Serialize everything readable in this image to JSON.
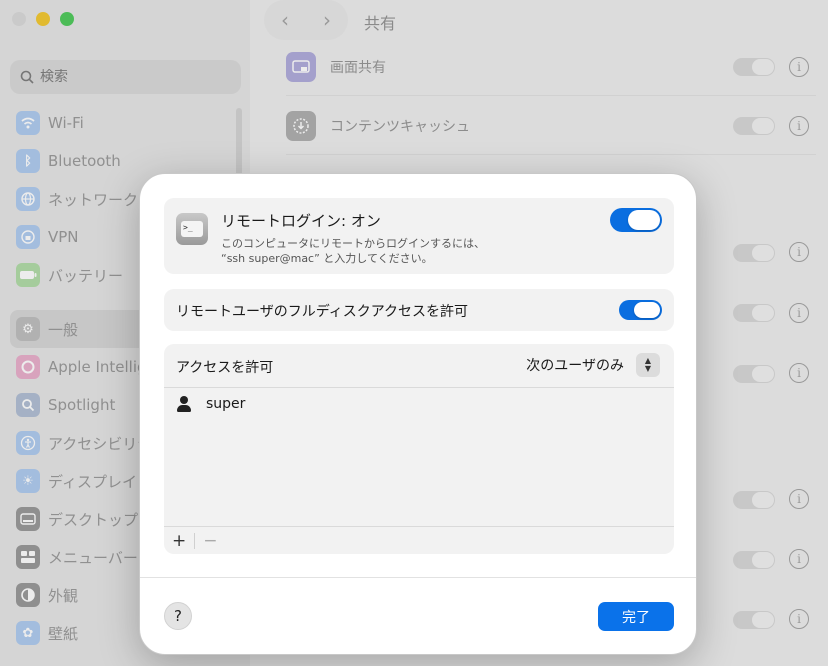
{
  "sidebar": {
    "search_placeholder": "検索",
    "items": [
      {
        "label": "Wi-Fi",
        "icon": "wifi-icon",
        "color": "#a7c6ee"
      },
      {
        "label": "Bluetooth",
        "icon": "bluetooth-icon",
        "color": "#a7c6ee"
      },
      {
        "label": "ネットワーク",
        "icon": "globe-icon",
        "color": "#a7c6ee"
      },
      {
        "label": "VPN",
        "icon": "vpn-icon",
        "color": "#a7c6ee"
      },
      {
        "label": "バッテリー",
        "icon": "battery-icon",
        "color": "#a9d89e"
      },
      {
        "label": "一般",
        "icon": "gear-icon",
        "color": "#b8b8b8"
      },
      {
        "label": "Apple Intellig",
        "icon": "apple-intelligence-icon",
        "color": "#e7a6c6"
      },
      {
        "label": "Spotlight",
        "icon": "spotlight-icon",
        "color": "#a9b8d0"
      },
      {
        "label": "アクセシビリテ",
        "icon": "accessibility-icon",
        "color": "#a7c6ee"
      },
      {
        "label": "ディスプレイ",
        "icon": "display-icon",
        "color": "#a7c6ee"
      },
      {
        "label": "デスクトップと",
        "icon": "desktop-icon",
        "color": "#8e8e8e"
      },
      {
        "label": "メニューバー",
        "icon": "menubar-icon",
        "color": "#8e8e8e"
      },
      {
        "label": "外観",
        "icon": "appearance-icon",
        "color": "#8e8e8e"
      },
      {
        "label": "壁紙",
        "icon": "wallpaper-icon",
        "color": "#a7c6ee"
      }
    ]
  },
  "header": {
    "back_glyph": "‹",
    "forward_glyph": "›",
    "title": "共有"
  },
  "background_rows": [
    {
      "label": "画面共有",
      "icon": "screen-sharing-icon",
      "color": "#a8a3d8"
    },
    {
      "label": "コンテンツキャッシュ",
      "icon": "content-caching-icon",
      "color": "#a6a6a6"
    }
  ],
  "sheet": {
    "remote_login": {
      "title": "リモートログイン: オン",
      "desc_line1": "このコンピュータにリモートからログインするには、",
      "desc_line2": "“ssh super@mac” と入力してください。",
      "enabled": true
    },
    "full_disk": {
      "label": "リモートユーザのフルディスクアクセスを許可",
      "enabled": true
    },
    "access": {
      "title": "アクセスを許可",
      "selected_option": "次のユーザのみ",
      "users": [
        "super"
      ],
      "add_label": "+",
      "remove_label": "−"
    },
    "help_label": "?",
    "done_label": "完了",
    "accent_color": "#0a72ea"
  }
}
